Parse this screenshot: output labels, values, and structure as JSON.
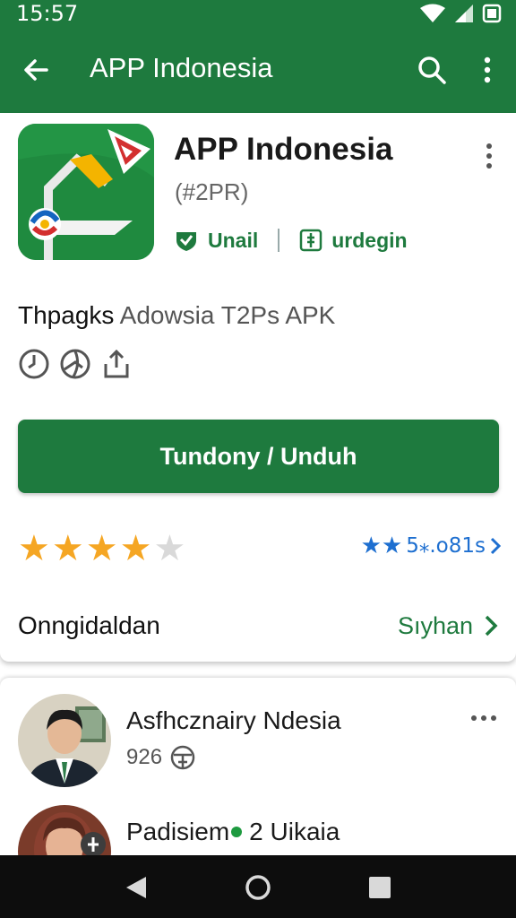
{
  "status_bar": {
    "time": "15:57"
  },
  "app_bar": {
    "title": "APP Indonesia"
  },
  "app": {
    "name": "APP Indonesia",
    "version": "(#2PR)",
    "badge_verified": "Unail",
    "badge_category": "urdegin",
    "subtitle_lead": "Thpagks",
    "subtitle_rest": " Adowsia T2Ps APK",
    "install_label": "Tundony / Unduh",
    "rating_stars": 4,
    "rating_max": 5,
    "review_count": "5⁎.o81s",
    "accent": "#1e7a3e",
    "star_color": "#f5a623",
    "link_color": "#1e6fd0"
  },
  "section": {
    "title": "Onngidaldan",
    "action": "Sıyhan"
  },
  "developer": {
    "name": "Asfhcznairy Ndesia",
    "count": "926"
  },
  "developer2": {
    "name": "Padisiem",
    "suffix": "2 Uikaia"
  }
}
